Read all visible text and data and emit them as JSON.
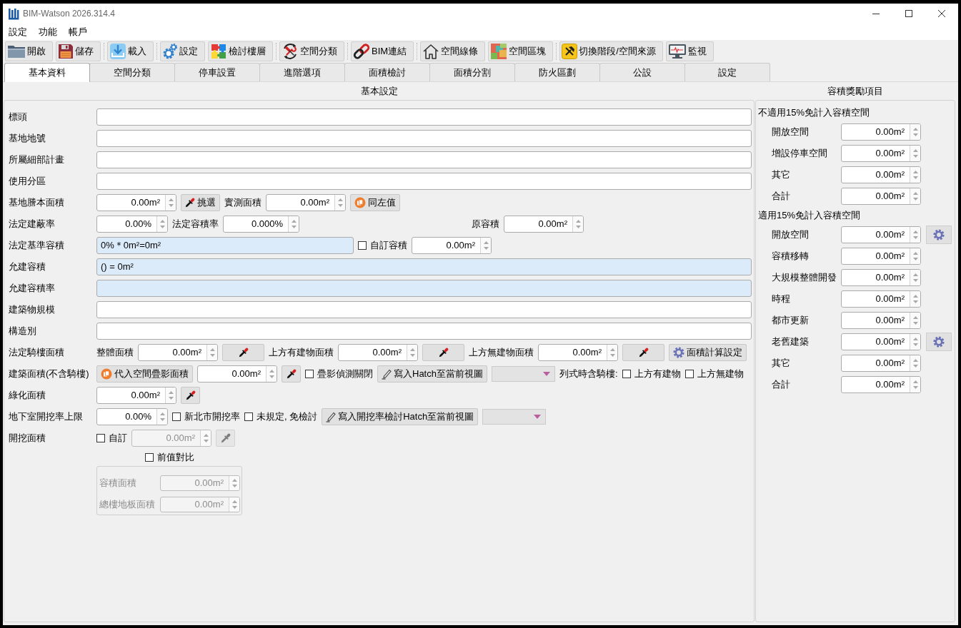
{
  "window": {
    "title": "BIM-Watson 2026.314.4"
  },
  "menu": [
    "設定",
    "功能",
    "帳戶"
  ],
  "toolbar": [
    [
      "開啟",
      "儲存"
    ],
    [
      "載入"
    ],
    [
      "設定",
      "檢討樓層"
    ],
    [
      "空間分類"
    ],
    [
      "BIM連結"
    ],
    [
      "空間線條",
      "空間區塊"
    ],
    [
      "切換階段/空間來源",
      "監視"
    ]
  ],
  "tabs": [
    {
      "label": "基本資料",
      "selected": true
    },
    {
      "label": "空間分類",
      "selected": false
    },
    {
      "label": "停車設置",
      "selected": false
    },
    {
      "label": "進階選項",
      "selected": false
    },
    {
      "label": "面積檢討",
      "selected": false
    },
    {
      "label": "面積分割",
      "selected": false
    },
    {
      "label": "防火區劃",
      "selected": false
    },
    {
      "label": "公設",
      "selected": false
    },
    {
      "label": "設定",
      "selected": false
    }
  ],
  "basic_settings": {
    "title": "基本設定",
    "rows": [
      {
        "label": "標頭",
        "controls": [
          {
            "kind": "text",
            "disabled": false
          }
        ]
      },
      {
        "label": "基地地號",
        "controls": [
          {
            "kind": "text",
            "disabled": false
          }
        ]
      },
      {
        "label": "所屬細部計畫",
        "controls": [
          {
            "kind": "text",
            "disabled": false
          }
        ]
      },
      {
        "label": "使用分區",
        "controls": [
          {
            "kind": "text",
            "disabled": false
          }
        ]
      },
      {
        "label": "基地謄本面積",
        "controls": [
          {
            "kind": "spin",
            "value": "0.00m²",
            "disabled": false
          },
          {
            "kind": "pick",
            "label": "挑選",
            "disabled": false
          },
          {
            "kind": "label",
            "text": "實測面積"
          },
          {
            "kind": "spin",
            "value": "0.00m²",
            "disabled": false
          },
          {
            "kind": "copy",
            "label": "同左值",
            "disabled": false
          }
        ]
      },
      {
        "label": "法定建蔽率",
        "controls": [
          {
            "kind": "spin",
            "value": "0.00%",
            "disabled": false
          },
          {
            "kind": "label",
            "text": "法定容積率"
          },
          {
            "kind": "spin",
            "value": "0.000%",
            "disabled": false
          },
          {
            "kind": "label",
            "text": "原容積"
          },
          {
            "kind": "spin",
            "value": "0.00m²",
            "disabled": false
          }
        ]
      },
      {
        "label": "法定基準容積",
        "controls": [
          {
            "kind": "readonly",
            "value": "0%＊0m²=0m²"
          },
          {
            "kind": "checkbox",
            "label": "自訂容積",
            "checked": false,
            "disabled": false
          },
          {
            "kind": "spin",
            "value": "0.00m²",
            "disabled": false
          }
        ]
      },
      {
        "label": "允建容積",
        "controls": [
          {
            "kind": "readonly",
            "value": "() = 0m²"
          }
        ]
      },
      {
        "label": "允建容積率",
        "controls": [
          {
            "kind": "readonly"
          }
        ]
      },
      {
        "label": "建築物規模",
        "controls": [
          {
            "kind": "text",
            "disabled": false
          }
        ]
      },
      {
        "label": "構造別",
        "controls": [
          {
            "kind": "text",
            "disabled": false
          }
        ]
      },
      {
        "label": "法定騎樓面積",
        "controls": [
          {
            "kind": "label",
            "text": "整體面積"
          },
          {
            "kind": "spin",
            "value": "0.00m²",
            "disabled": false
          },
          {
            "kind": "pick",
            "disabled": false
          },
          {
            "kind": "label",
            "text": "上方有建物面積"
          },
          {
            "kind": "spin",
            "value": "0.00m²",
            "disabled": false
          },
          {
            "kind": "pick",
            "disabled": false
          },
          {
            "kind": "label",
            "text": "上方無建物面積"
          },
          {
            "kind": "spin",
            "value": "0.00m²",
            "disabled": false
          },
          {
            "kind": "pick",
            "disabled": false
          },
          {
            "kind": "settings",
            "label": "面積計算設定",
            "disabled": false
          }
        ]
      },
      {
        "label": "建築面積(不含騎樓)",
        "controls": [
          {
            "kind": "copy",
            "label": "代入空間疊影面積",
            "disabled": false
          },
          {
            "kind": "spin",
            "value": "0.00m²",
            "disabled": false
          },
          {
            "kind": "pick",
            "disabled": false
          },
          {
            "kind": "checkbox",
            "label": "疊影偵測關閉",
            "checked": false,
            "disabled": false
          },
          {
            "kind": "write",
            "label": "寫入Hatch至當前視圖",
            "disabled": false
          },
          {
            "kind": "combo",
            "disabled": false
          },
          {
            "kind": "label",
            "text": "列式時含騎樓:"
          },
          {
            "kind": "checkbox",
            "label": "上方有建物",
            "checked": false,
            "disabled": false
          },
          {
            "kind": "checkbox",
            "label": "上方無建物",
            "checked": false,
            "disabled": false
          }
        ]
      },
      {
        "label": "綠化面積",
        "controls": [
          {
            "kind": "spin",
            "value": "0.00m²",
            "disabled": false
          },
          {
            "kind": "pick",
            "disabled": false
          }
        ]
      },
      {
        "label": "地下室開挖率上限",
        "controls": [
          {
            "kind": "spin",
            "value": "0.00%",
            "disabled": false
          },
          {
            "kind": "checkbox",
            "label": "新北市開挖率",
            "checked": false,
            "disabled": false
          },
          {
            "kind": "checkbox",
            "label": "未規定, 免檢討",
            "checked": false,
            "disabled": false
          },
          {
            "kind": "write",
            "label": "寫入開挖率檢討Hatch至當前視圖",
            "disabled": false
          },
          {
            "kind": "combo",
            "disabled": false
          }
        ]
      },
      {
        "label": "開挖面積",
        "controls": [
          {
            "kind": "checkbox",
            "label": "自訂",
            "checked": false,
            "disabled": false
          },
          {
            "kind": "spin",
            "value": "0.00m²",
            "disabled": true
          },
          {
            "kind": "pick",
            "disabled": true
          }
        ]
      },
      {
        "controls": [
          {
            "kind": "checkbox",
            "label": "前值對比",
            "checked": false,
            "disabled": false
          }
        ]
      }
    ],
    "comparison_group": {
      "disabled": true,
      "rows": [
        {
          "label": "容積面積",
          "value": "0.00m²"
        },
        {
          "label": "總樓地板面積",
          "value": "0.00m²"
        }
      ]
    }
  },
  "bonus_items": {
    "title": "容積獎勵項目",
    "sections": [
      {
        "title": "不適用15%免計入容積空間",
        "items": [
          {
            "label": "開放空間",
            "value": "0.00m²",
            "settings_button": false
          },
          {
            "label": "增設停車空間",
            "value": "0.00m²",
            "settings_button": false
          },
          {
            "label": "其它",
            "value": "0.00m²",
            "settings_button": false
          },
          {
            "label": "合計",
            "value": "0.00m²",
            "settings_button": false
          }
        ]
      },
      {
        "title": "適用15%免計入容積空間",
        "items": [
          {
            "label": "開放空間",
            "value": "0.00m²",
            "settings_button": true
          },
          {
            "label": "容積移轉",
            "value": "0.00m²",
            "settings_button": false
          },
          {
            "label": "大規模整體開發",
            "value": "0.00m²",
            "settings_button": false
          },
          {
            "label": "時程",
            "value": "0.00m²",
            "settings_button": false
          },
          {
            "label": "都市更新",
            "value": "0.00m²",
            "settings_button": false
          },
          {
            "label": "老舊建築",
            "value": "0.00m²",
            "settings_button": true
          },
          {
            "label": "其它",
            "value": "0.00m²",
            "settings_button": false
          },
          {
            "label": "合計",
            "value": "0.00m²",
            "settings_button": false
          }
        ]
      }
    ]
  }
}
